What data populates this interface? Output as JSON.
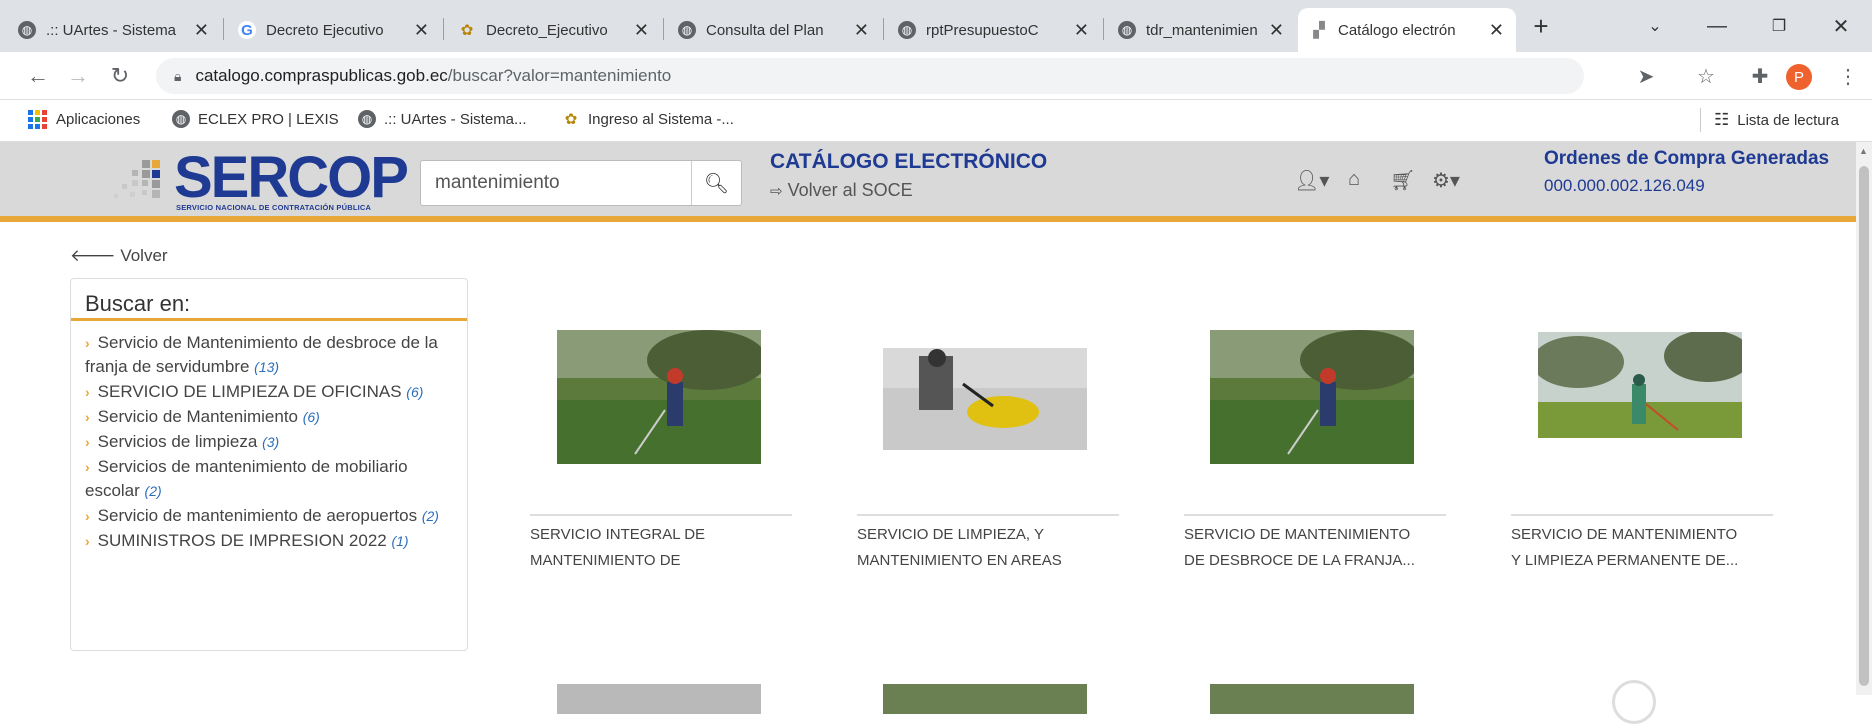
{
  "tabs": [
    {
      "title": ".:: UArtes - Sistema",
      "icon": "globe-icon"
    },
    {
      "title": "Decreto Ejecutivo",
      "icon": "google-icon"
    },
    {
      "title": "Decreto_Ejecutivo",
      "icon": "bee-icon"
    },
    {
      "title": "Consulta del Plan",
      "icon": "globe-icon"
    },
    {
      "title": "rptPresupuestoC",
      "icon": "globe-icon"
    },
    {
      "title": "tdr_mantenimien",
      "icon": "globe-icon"
    },
    {
      "title": "Catálogo electrón",
      "icon": "sercop-icon"
    }
  ],
  "browser": {
    "url_host": "catalogo.compraspublicas.gob.ec",
    "url_path": "/buscar?valor=mantenimiento",
    "profile_initial": "P"
  },
  "bookmarks": [
    {
      "label": "Aplicaciones"
    },
    {
      "label": "ECLEX PRO | LEXIS"
    },
    {
      "label": ".:: UArtes - Sistema..."
    },
    {
      "label": "Ingreso al Sistema -..."
    }
  ],
  "reading_list": "Lista de lectura",
  "header": {
    "logo_text": "SERCOP",
    "logo_sub": "SERVICIO NACIONAL DE CONTRATACIÓN PÚBLICA",
    "search_value": "mantenimiento",
    "title": "CATÁLOGO ELECTRÓNICO",
    "back_link": "Volver al SOCE",
    "orders_title": "Ordenes de Compra Generadas",
    "orders_number": "000.000.002.126.049",
    "brand_color": "#1f3a93",
    "accent_color": "#e8a838"
  },
  "back": "Volver",
  "facets": {
    "title": "Buscar en:",
    "items": [
      {
        "label": "Servicio de Mantenimiento de desbroce de la franja de servidumbre",
        "count": "(13)"
      },
      {
        "label": "SERVICIO DE LIMPIEZA DE OFICINAS",
        "count": "(6)"
      },
      {
        "label": "Servicio de Mantenimiento",
        "count": "(6)"
      },
      {
        "label": "Servicios de limpieza",
        "count": "(3)"
      },
      {
        "label": "Servicios de mantenimiento de mobiliario escolar",
        "count": "(2)"
      },
      {
        "label": "Servicio de mantenimiento de aeropuertos",
        "count": "(2)"
      },
      {
        "label": "SUMINISTROS DE IMPRESION 2022",
        "count": "(1)"
      }
    ]
  },
  "products": [
    {
      "line1": "SERVICIO INTEGRAL DE",
      "line2": "MANTENIMIENTO DE"
    },
    {
      "line1": "SERVICIO DE LIMPIEZA, Y",
      "line2": "MANTENIMIENTO EN AREAS"
    },
    {
      "line1": "SERVICIO DE MANTENIMIENTO",
      "line2": "DE DESBROCE DE LA FRANJA..."
    },
    {
      "line1": "SERVICIO DE MANTENIMIENTO",
      "line2": "Y LIMPIEZA PERMANENTE DE..."
    }
  ]
}
